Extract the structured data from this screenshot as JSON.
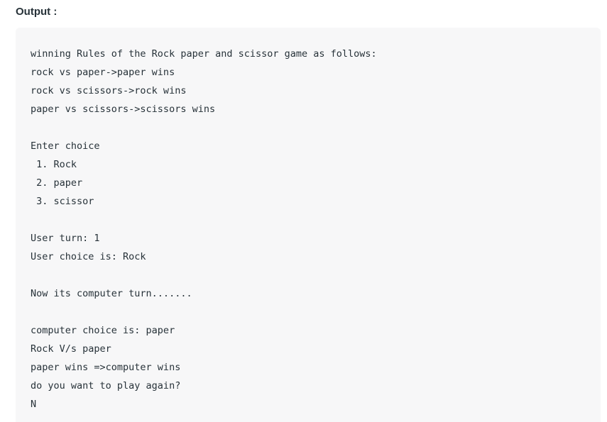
{
  "heading": "Output :",
  "output": {
    "lines": [
      "winning Rules of the Rock paper and scissor game as follows:",
      "rock vs paper->paper wins",
      "rock vs scissors->rock wins",
      "paper vs scissors->scissors wins",
      "",
      "Enter choice",
      " 1. Rock",
      " 2. paper",
      " 3. scissor",
      "",
      "User turn: 1",
      "User choice is: Rock",
      "",
      "Now its computer turn.......",
      "",
      "computer choice is: paper",
      "Rock V/s paper",
      "paper wins =>computer wins",
      "do you want to play again?",
      "N"
    ]
  }
}
